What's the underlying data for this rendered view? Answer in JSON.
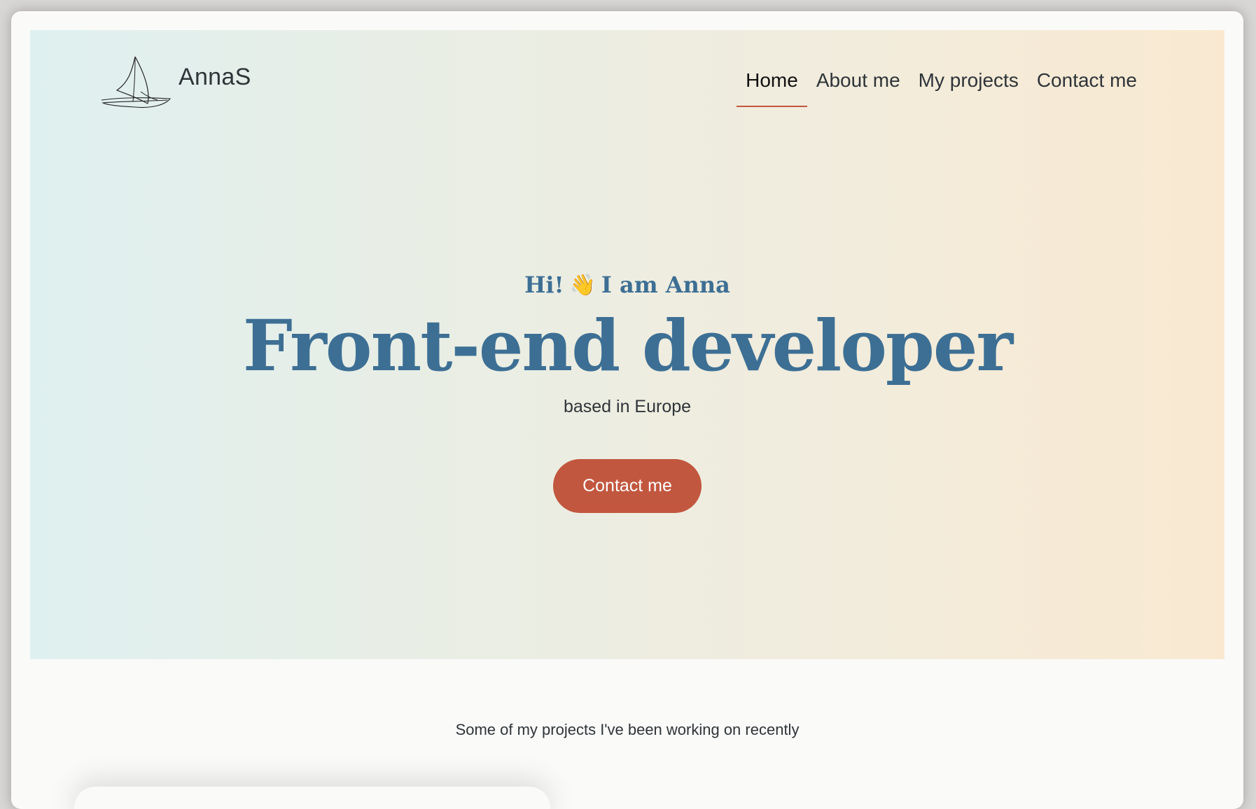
{
  "brand": {
    "name": "AnnaS",
    "logo_icon": "sailboat-icon"
  },
  "nav": {
    "items": [
      {
        "label": "Home",
        "active": true
      },
      {
        "label": "About me",
        "active": false
      },
      {
        "label": "My projects",
        "active": false
      },
      {
        "label": "Contact me",
        "active": false
      }
    ]
  },
  "hero": {
    "greeting_before": "Hi!",
    "wave_icon": "👋",
    "greeting_after": "I am Anna",
    "headline": "Front-end developer",
    "subline": "based in Europe",
    "cta_label": "Contact me"
  },
  "projects": {
    "intro": "Some of my projects I've been working on recently"
  },
  "colors": {
    "accent": "#c2573f",
    "primary_text": "#3d6f94",
    "body_text": "#2e3438"
  }
}
